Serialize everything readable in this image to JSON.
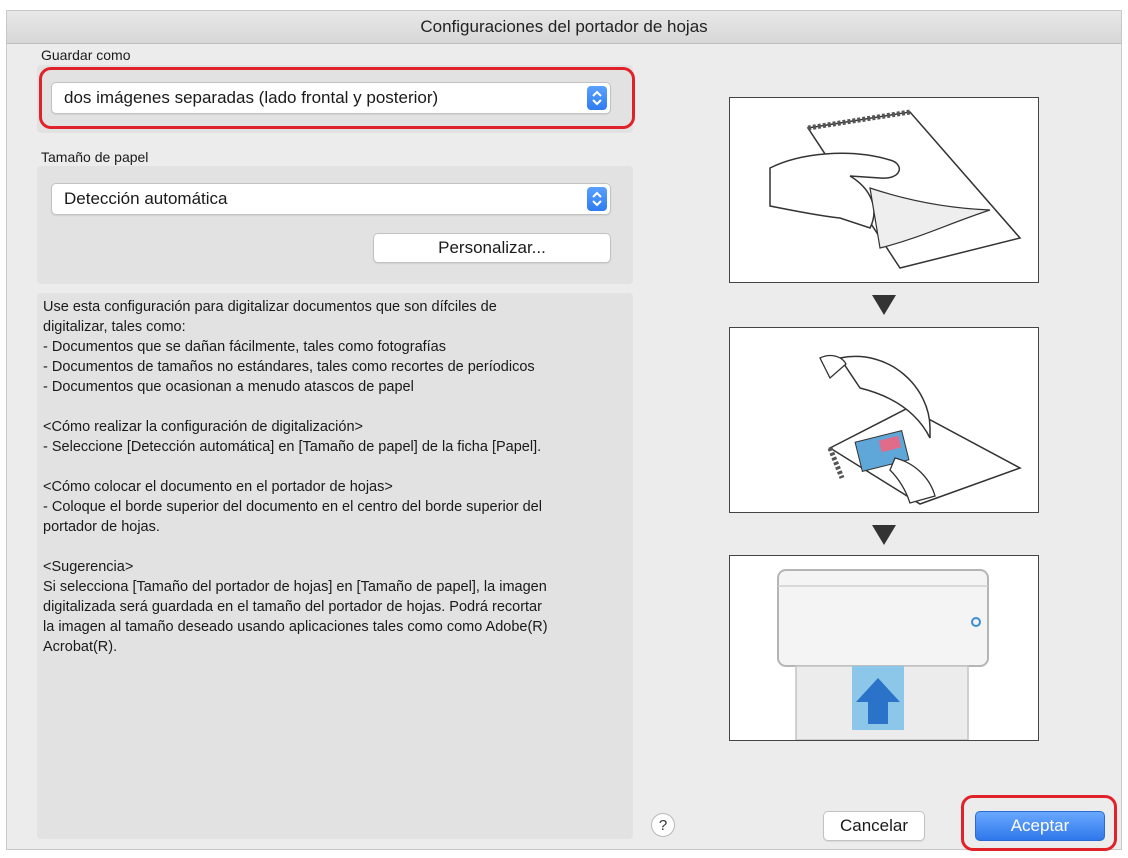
{
  "window": {
    "title": "Configuraciones del portador de hojas"
  },
  "save_as": {
    "label": "Guardar como",
    "selected": "dos imágenes separadas (lado frontal y posterior)"
  },
  "paper_size": {
    "label": "Tamaño de papel",
    "selected": "Detección automática",
    "customize_label": "Personalizar..."
  },
  "description": {
    "paragraphs": [
      "Use esta configuración para digitalizar documentos que son dífciles de\ndigitalizar, tales como:\n- Documentos que se dañan fácilmente, tales como fotografías\n- Documentos de tamaños no estándares, tales como recortes de períodicos\n- Documentos que ocasionan a menudo atascos de papel",
      "<Cómo realizar la configuración de digitalización>\n- Seleccione [Detección automática] en [Tamaño de papel] de la ficha [Papel].",
      "<Cómo colocar el documento en el portador de hojas>\n- Coloque el borde superior del documento en el centro del borde superior del\nportador de hojas.",
      "<Sugerencia>\nSi selecciona [Tamaño del portador de hojas] en [Tamaño de papel], la imagen\ndigitalizada será guardada en el tamaño del portador de hojas. Podrá recortar\nla imagen al tamaño deseado usando aplicaciones tales como como Adobe(R)\nAcrobat(R)."
    ]
  },
  "footer": {
    "help_label": "?",
    "cancel_label": "Cancelar",
    "ok_label": "Aceptar"
  },
  "colors": {
    "highlight": "#e0222b",
    "accent": "#2f78ea",
    "panel": "#e2e2e2"
  },
  "icons": [
    "chevron-updown-icon",
    "help-icon",
    "arrow-down-icon",
    "scanner-icon"
  ]
}
